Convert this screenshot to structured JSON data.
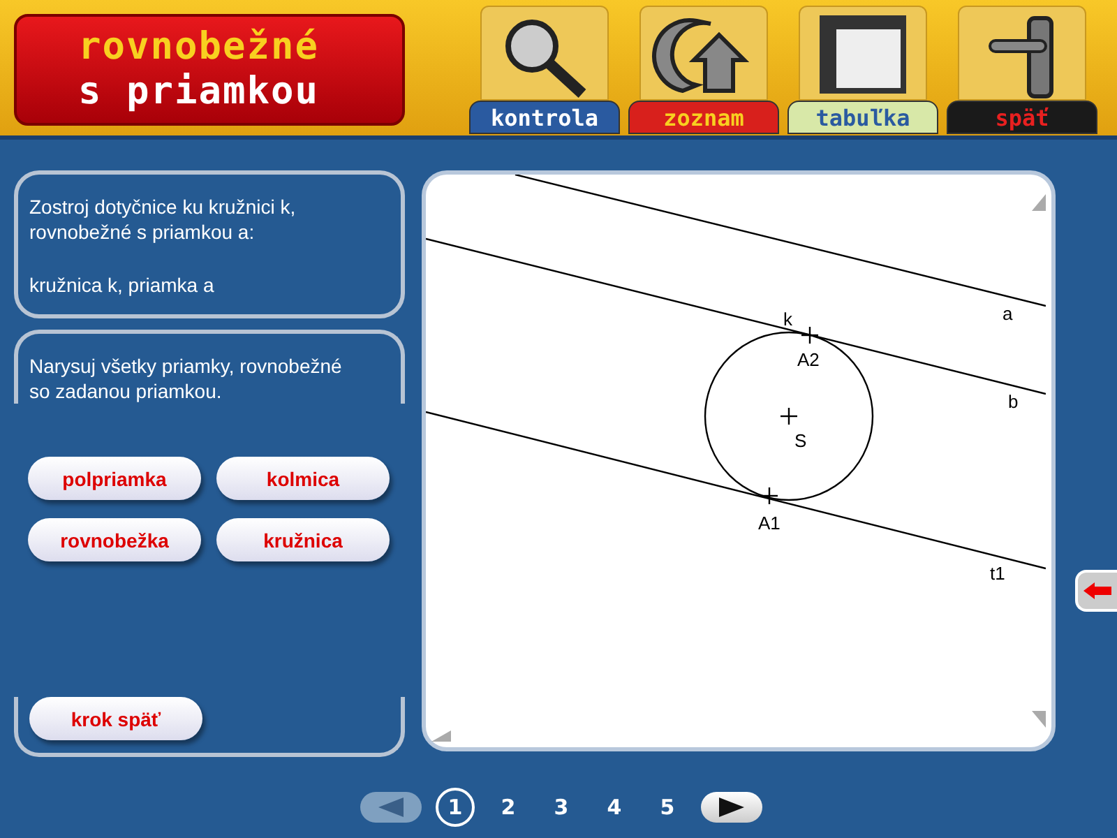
{
  "header": {
    "title": [
      "rovnobežné",
      "s priamkou"
    ],
    "tools": [
      {
        "label": "kontrola",
        "kind": "magnifier",
        "color": "#2a5aa0"
      },
      {
        "label": "zoznam",
        "kind": "cycle",
        "color": "#d8201c"
      },
      {
        "label": "tabuľka",
        "kind": "table",
        "color": "#d8e8a8"
      },
      {
        "label": "späť",
        "kind": "door",
        "color": "#1a1a1a"
      }
    ]
  },
  "task": {
    "text": "Zostroj dotyčnice ku kružnici k, rovnobežné s priamkou a:",
    "given": "kružnica k, priamka a"
  },
  "hint": {
    "text": "Narysuj všetky priamky, rovnobežné so zadanou priamkou."
  },
  "tool_buttons": [
    "polpriamka",
    "kolmica",
    "rovnobežka",
    "kružnica"
  ],
  "undo_button": "krok späť",
  "drawing": {
    "labels": {
      "line_a": "a",
      "line_b": "b",
      "line_t1": "t1",
      "circle": "k",
      "point_a2": "A2",
      "center": "S",
      "point_a1": "A1"
    }
  },
  "pagination": {
    "pages": [
      {
        "label": "1",
        "selected": true
      },
      {
        "label": "2",
        "selected": false
      },
      {
        "label": "3",
        "selected": false
      },
      {
        "label": "4",
        "selected": false
      },
      {
        "label": "5",
        "selected": false
      }
    ]
  }
}
